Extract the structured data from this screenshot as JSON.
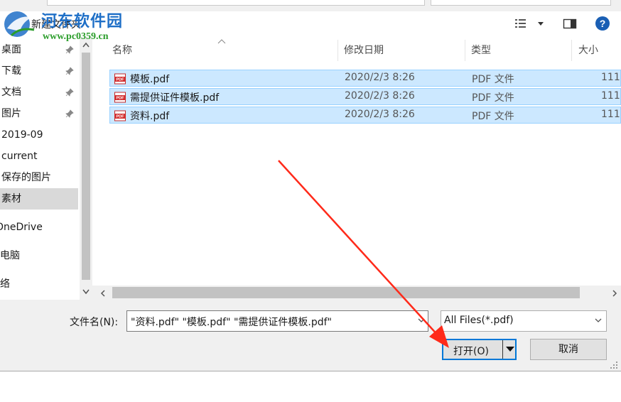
{
  "watermark": {
    "site_name": "河东软件园",
    "url": "www.pc0359.cn"
  },
  "toolbar": {
    "new_folder_label": "新建文件夹",
    "view_icon": "details-view-icon",
    "preview_icon": "preview-pane-icon",
    "help_icon": "help-icon"
  },
  "nav": {
    "items": [
      {
        "label": "桌面",
        "pinned": true
      },
      {
        "label": "下载",
        "pinned": true
      },
      {
        "label": "文档",
        "pinned": true
      },
      {
        "label": "图片",
        "pinned": true
      },
      {
        "label": "2019-09",
        "pinned": false
      },
      {
        "label": "current",
        "pinned": false
      },
      {
        "label": "保存的图片",
        "pinned": false
      },
      {
        "label": "素材",
        "pinned": false,
        "selected": true
      },
      {
        "label": "OneDrive",
        "pinned": false
      },
      {
        "label": "此电脑",
        "pinned": false
      },
      {
        "label": "网络",
        "pinned": false
      }
    ]
  },
  "list": {
    "columns": {
      "name": "名称",
      "modified": "修改日期",
      "type": "类型",
      "size": "大小"
    },
    "files": [
      {
        "name": "模板.pdf",
        "modified": "2020/2/3 8:26",
        "type": "PDF 文件",
        "size": "111"
      },
      {
        "name": "需提供证件模板.pdf",
        "modified": "2020/2/3 8:26",
        "type": "PDF 文件",
        "size": "111"
      },
      {
        "name": "资料.pdf",
        "modified": "2020/2/3 8:26",
        "type": "PDF 文件",
        "size": "111"
      }
    ]
  },
  "footer": {
    "filename_label": "文件名(N):",
    "filename_value": "\"资料.pdf\" \"模板.pdf\" \"需提供证件模板.pdf\"",
    "filter_value": "All Files(*.pdf)",
    "open_label": "打开(O)",
    "cancel_label": "取消"
  },
  "colors": {
    "selection": "#cce8ff",
    "accent": "#0078d7",
    "annotation_arrow": "#ff2a1a"
  }
}
